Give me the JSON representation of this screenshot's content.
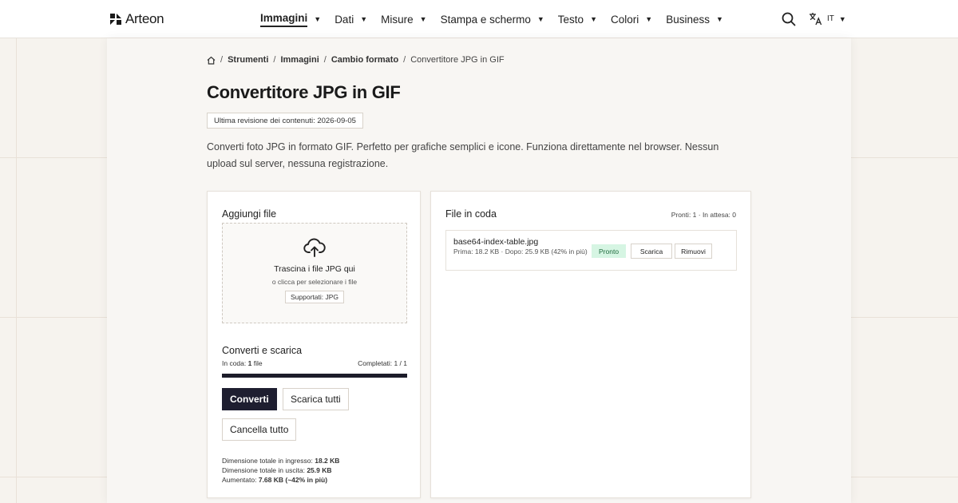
{
  "brand": {
    "name": "Arteon"
  },
  "nav": {
    "items": [
      {
        "label": "Immagini",
        "active": true
      },
      {
        "label": "Dati"
      },
      {
        "label": "Misure"
      },
      {
        "label": "Stampa e schermo"
      },
      {
        "label": "Testo"
      },
      {
        "label": "Colori"
      },
      {
        "label": "Business"
      }
    ],
    "language": "IT"
  },
  "breadcrumb": {
    "items": [
      "Strumenti",
      "Immagini",
      "Cambio formato"
    ],
    "current": "Convertitore JPG in GIF"
  },
  "page": {
    "title": "Convertitore JPG in GIF",
    "revision": "Ultima revisione dei contenuti: 2026-09-05",
    "description": "Converti foto JPG in formato GIF. Perfetto per grafiche semplici e icone. Funziona direttamente nel browser. Nessun upload sul server, nessuna registrazione."
  },
  "upload": {
    "title": "Aggiungi file",
    "drop_title": "Trascina i file JPG qui",
    "drop_sub": "o clicca per selezionare i file",
    "supported": "Supportati: JPG"
  },
  "convert": {
    "title": "Converti e scarica",
    "queued_label": "In coda: ",
    "queued_value": "1",
    "queued_suffix": " file",
    "completed": "Completati: 1 / 1",
    "progress": 1.0,
    "convert_button": "Converti",
    "download_all_button": "Scarica tutti",
    "cancel_all_button": "Cancella tutto",
    "total_in_label": "Dimensione totale in ingresso: ",
    "total_in_value": "18.2 KB",
    "total_out_label": "Dimensione totale in uscita: ",
    "total_out_value": "25.9 KB",
    "increase_label": "Aumentato: ",
    "increase_value": "7.68 KB (~42% in più)"
  },
  "queue": {
    "title": "File in coda",
    "counts": "Pronti: 1 · In attesa: 0",
    "files": [
      {
        "name": "base64-index-table.jpg",
        "meta": "Prima: 18.2 KB · Dopo: 25.9 KB (42% in più)",
        "status": "Pronto",
        "download": "Scarica",
        "remove": "Rimuovi"
      }
    ]
  },
  "colors": {
    "primary_button": "#1e1e30",
    "ready_badge_bg": "#d6f5e3",
    "page_bg": "#f6f3ee"
  }
}
